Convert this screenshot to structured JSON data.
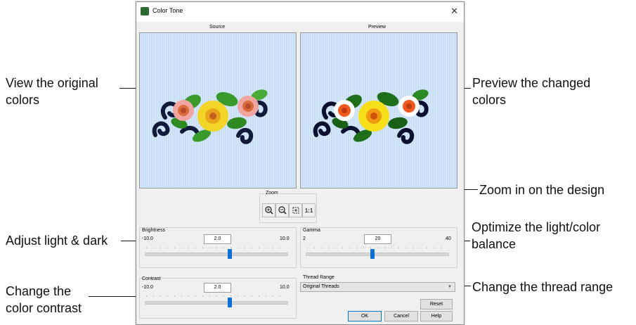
{
  "dialog": {
    "title": "Color Tone",
    "close_label": "✕",
    "source_label": "Source",
    "preview_label": "Preview",
    "zoom": {
      "label": "Zoom",
      "zoom_in_icon": "zoom-in-icon",
      "zoom_out_icon": "zoom-out-icon",
      "fit_icon": "zoom-fit-icon",
      "actual_size_label": "1:1"
    },
    "brightness": {
      "label": "Brightness",
      "min": "-10.0",
      "max": "10.0",
      "value": "2.0",
      "fraction": 0.6
    },
    "gamma": {
      "label": "Gamma",
      "min": "2",
      "max": "40",
      "value": "20",
      "fraction": 0.47
    },
    "contrast": {
      "label": "Contrast",
      "min": "-10.0",
      "max": "10.0",
      "value": "2.0",
      "fraction": 0.6
    },
    "thread_range": {
      "label": "Thread Range",
      "value": "Original Threads"
    },
    "buttons": {
      "reset": "Reset",
      "ok": "OK",
      "cancel": "Cancel",
      "help": "Help"
    }
  },
  "callouts": {
    "view_original": "View the original colors",
    "preview_changed": "Preview the changed colors",
    "zoom": "Zoom in on the design",
    "adjust": "Adjust light & dark",
    "optimize": "Optimize the light/color balance",
    "contrast": "Change the color contrast",
    "thread": "Change the thread range"
  },
  "colors": {
    "accent": "#0a6fd6",
    "preview_bg": "#c8def7"
  }
}
